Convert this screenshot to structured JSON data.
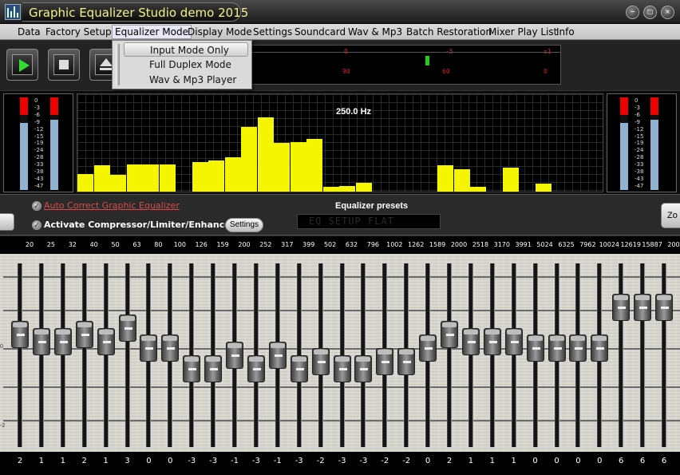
{
  "window": {
    "title": "Graphic Equalizer Studio demo 2015",
    "controls": [
      "minimize-icon",
      "maximize-icon",
      "close-icon"
    ]
  },
  "menu": {
    "items": [
      "Data",
      "Factory Setups",
      "Equalizer Mode",
      "Display Mode",
      "Settings",
      "Soundcard",
      "Wav & Mp3",
      "Batch Restoration",
      "Mixer Play List",
      "Info"
    ],
    "open_item": "Equalizer Mode",
    "dropdown": [
      "Input Mode Only",
      "Full Duplex Mode",
      "Wav & Mp3 Player"
    ],
    "highlighted": "Input Mode Only"
  },
  "toolbar": {
    "buttons": [
      "play-icon",
      "stop-icon",
      "eject-icon"
    ],
    "level_labels": [
      "0",
      "-5",
      "±1",
      "90",
      "60",
      "0"
    ]
  },
  "vu_labels": [
    "0",
    "-3",
    "-6",
    "-9",
    "-12",
    "-15",
    "-19",
    "-24",
    "-28",
    "-33",
    "-38",
    "-43",
    "-47"
  ],
  "spectrum": {
    "readout": "250.0 Hz",
    "levels": [
      0.18,
      0.27,
      0.17,
      0.28,
      0.28,
      0.28,
      0,
      0.3,
      0.32,
      0.35,
      0.66,
      0.76,
      0.5,
      0.51,
      0.54,
      0.05,
      0.06,
      0.09,
      0,
      0,
      0,
      0,
      0.27,
      0.23,
      0.05,
      0,
      0.25,
      0,
      0.08,
      0,
      0,
      0
    ]
  },
  "controls": {
    "auto_correct": "Auto Correct Graphic Equalizer",
    "compressor": "Activate Compressor/Limiter/Enhancer",
    "settings": "Settings",
    "presets_title": "Equalizer presets",
    "preset_value": "EQ SETUP FLAT",
    "zoom_label": "Zo"
  },
  "bands": {
    "freqs": [
      "20",
      "25",
      "32",
      "40",
      "50",
      "63",
      "80",
      "100",
      "126",
      "159",
      "200",
      "252",
      "317",
      "399",
      "502",
      "632",
      "796",
      "1002",
      "1262",
      "1589",
      "2000",
      "2518",
      "3170",
      "3991",
      "5024",
      "6325",
      "7962",
      "10024",
      "12619",
      "15887",
      "200"
    ],
    "values": [
      "2",
      "1",
      "1",
      "2",
      "1",
      "3",
      "0",
      "0",
      "-3",
      "-3",
      "-1",
      "-3",
      "-1",
      "-3",
      "-2",
      "-3",
      "-3",
      "-2",
      "-2",
      "0",
      "2",
      "1",
      "1",
      "1",
      "0",
      "0",
      "0",
      "0",
      "6",
      "6",
      "6"
    ]
  },
  "side_ticks": [
    "",
    "0",
    "-2"
  ]
}
